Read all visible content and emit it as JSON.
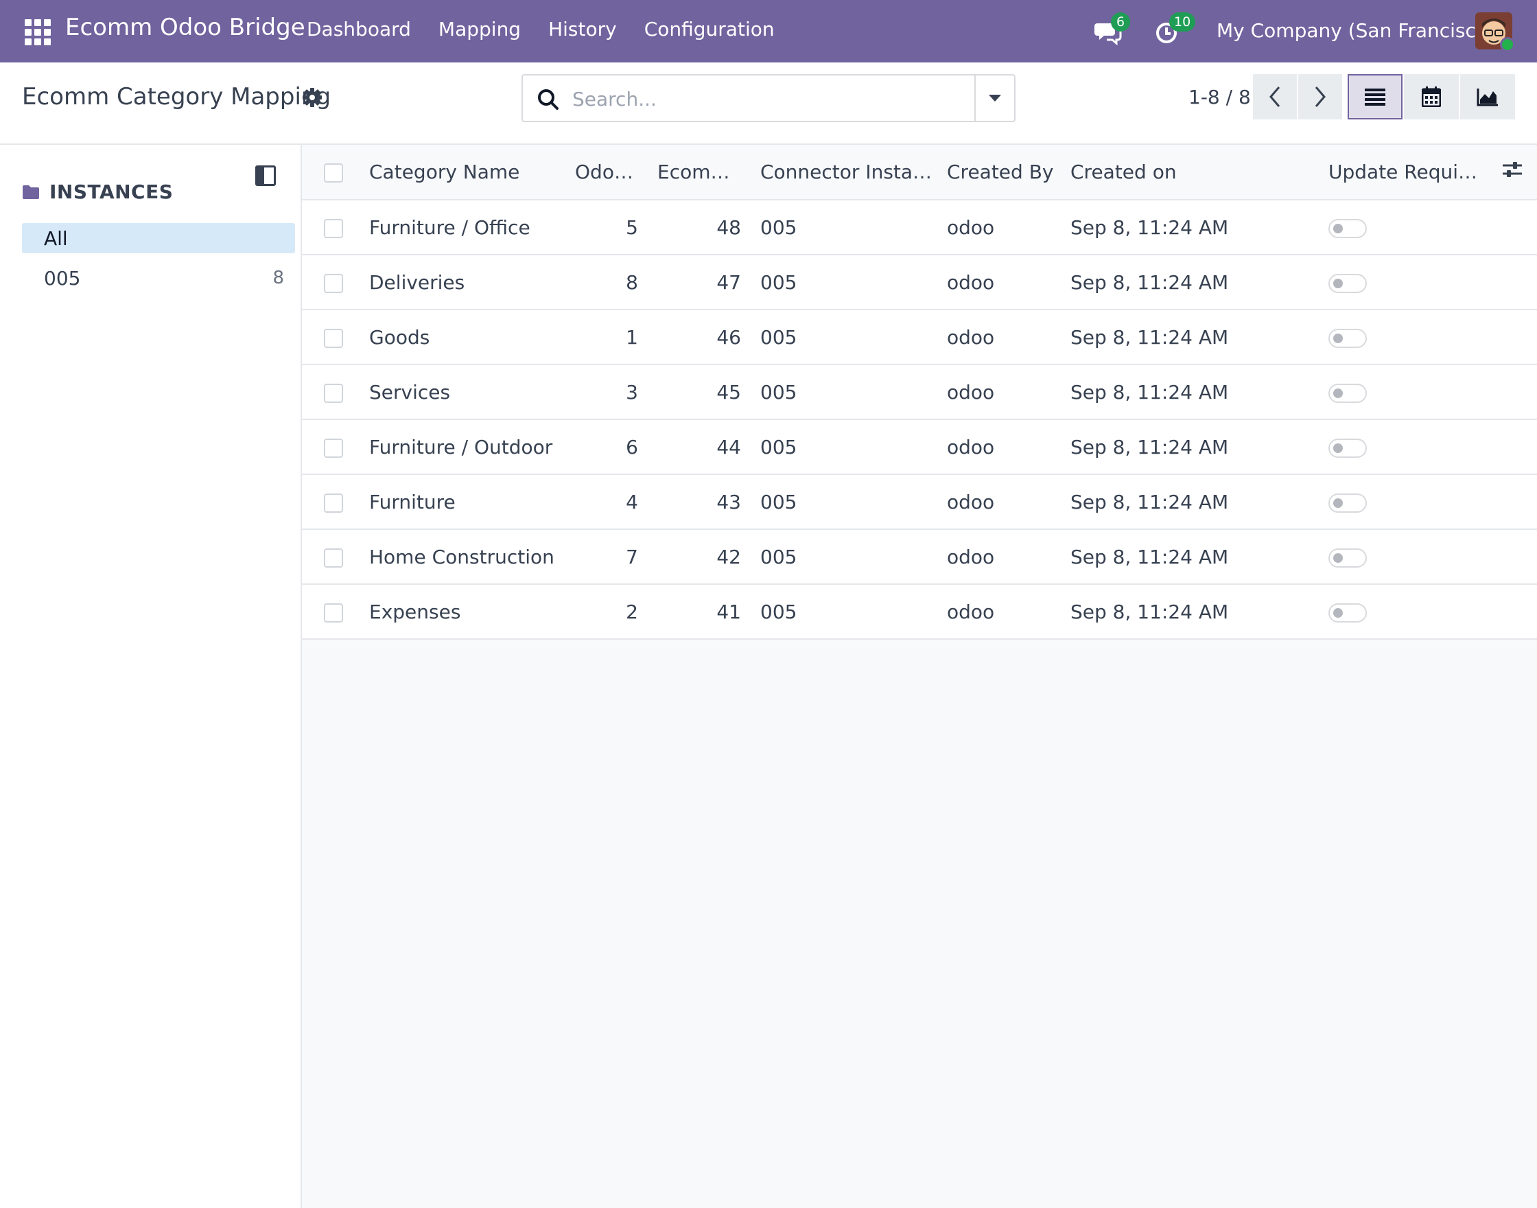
{
  "navbar": {
    "brand": "Ecomm Odoo Bridge",
    "menu": [
      "Dashboard",
      "Mapping",
      "History",
      "Configuration"
    ],
    "messages_count": "6",
    "activities_count": "10",
    "company": "My Company (San Francisco)",
    "icons": [
      "apps-grid-icon",
      "chat-icon",
      "clock-icon",
      "avatar"
    ]
  },
  "control": {
    "title": "Ecomm Category Mapping",
    "search_placeholder": "Search...",
    "pager": "1-8 / 8",
    "views": [
      "list",
      "calendar",
      "graph"
    ],
    "active_view": "list"
  },
  "sidepanel": {
    "header": "INSTANCES",
    "items": [
      {
        "label": "All",
        "count": ""
      },
      {
        "label": "005",
        "count": "8"
      }
    ]
  },
  "table": {
    "columns": [
      "Category Name",
      "Odoo Id",
      "Ecomm Id",
      "Connector Instance",
      "Created By",
      "Created on",
      "Update Requir..."
    ],
    "rows": [
      {
        "name": "Furniture / Office",
        "odoo_id": "5",
        "ecomm_id": "48",
        "instance": "005",
        "created_by": "odoo",
        "created_on": "Sep 8, 11:24 AM",
        "update_required": false
      },
      {
        "name": "Deliveries",
        "odoo_id": "8",
        "ecomm_id": "47",
        "instance": "005",
        "created_by": "odoo",
        "created_on": "Sep 8, 11:24 AM",
        "update_required": false
      },
      {
        "name": "Goods",
        "odoo_id": "1",
        "ecomm_id": "46",
        "instance": "005",
        "created_by": "odoo",
        "created_on": "Sep 8, 11:24 AM",
        "update_required": false
      },
      {
        "name": "Services",
        "odoo_id": "3",
        "ecomm_id": "45",
        "instance": "005",
        "created_by": "odoo",
        "created_on": "Sep 8, 11:24 AM",
        "update_required": false
      },
      {
        "name": "Furniture / Outdoor",
        "odoo_id": "6",
        "ecomm_id": "44",
        "instance": "005",
        "created_by": "odoo",
        "created_on": "Sep 8, 11:24 AM",
        "update_required": false
      },
      {
        "name": "Furniture",
        "odoo_id": "4",
        "ecomm_id": "43",
        "instance": "005",
        "created_by": "odoo",
        "created_on": "Sep 8, 11:24 AM",
        "update_required": false
      },
      {
        "name": "Home Construction",
        "odoo_id": "7",
        "ecomm_id": "42",
        "instance": "005",
        "created_by": "odoo",
        "created_on": "Sep 8, 11:24 AM",
        "update_required": false
      },
      {
        "name": "Expenses",
        "odoo_id": "2",
        "ecomm_id": "41",
        "instance": "005",
        "created_by": "odoo",
        "created_on": "Sep 8, 11:24 AM",
        "update_required": false
      }
    ]
  }
}
